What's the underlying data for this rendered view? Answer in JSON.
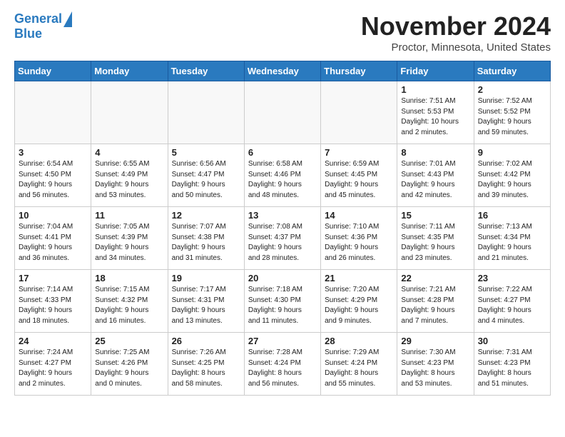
{
  "header": {
    "logo_line1": "General",
    "logo_line2": "Blue",
    "month_title": "November 2024",
    "location": "Proctor, Minnesota, United States"
  },
  "weekdays": [
    "Sunday",
    "Monday",
    "Tuesday",
    "Wednesday",
    "Thursday",
    "Friday",
    "Saturday"
  ],
  "weeks": [
    [
      {
        "day": "",
        "info": ""
      },
      {
        "day": "",
        "info": ""
      },
      {
        "day": "",
        "info": ""
      },
      {
        "day": "",
        "info": ""
      },
      {
        "day": "",
        "info": ""
      },
      {
        "day": "1",
        "info": "Sunrise: 7:51 AM\nSunset: 5:53 PM\nDaylight: 10 hours\nand 2 minutes."
      },
      {
        "day": "2",
        "info": "Sunrise: 7:52 AM\nSunset: 5:52 PM\nDaylight: 9 hours\nand 59 minutes."
      }
    ],
    [
      {
        "day": "3",
        "info": "Sunrise: 6:54 AM\nSunset: 4:50 PM\nDaylight: 9 hours\nand 56 minutes."
      },
      {
        "day": "4",
        "info": "Sunrise: 6:55 AM\nSunset: 4:49 PM\nDaylight: 9 hours\nand 53 minutes."
      },
      {
        "day": "5",
        "info": "Sunrise: 6:56 AM\nSunset: 4:47 PM\nDaylight: 9 hours\nand 50 minutes."
      },
      {
        "day": "6",
        "info": "Sunrise: 6:58 AM\nSunset: 4:46 PM\nDaylight: 9 hours\nand 48 minutes."
      },
      {
        "day": "7",
        "info": "Sunrise: 6:59 AM\nSunset: 4:45 PM\nDaylight: 9 hours\nand 45 minutes."
      },
      {
        "day": "8",
        "info": "Sunrise: 7:01 AM\nSunset: 4:43 PM\nDaylight: 9 hours\nand 42 minutes."
      },
      {
        "day": "9",
        "info": "Sunrise: 7:02 AM\nSunset: 4:42 PM\nDaylight: 9 hours\nand 39 minutes."
      }
    ],
    [
      {
        "day": "10",
        "info": "Sunrise: 7:04 AM\nSunset: 4:41 PM\nDaylight: 9 hours\nand 36 minutes."
      },
      {
        "day": "11",
        "info": "Sunrise: 7:05 AM\nSunset: 4:39 PM\nDaylight: 9 hours\nand 34 minutes."
      },
      {
        "day": "12",
        "info": "Sunrise: 7:07 AM\nSunset: 4:38 PM\nDaylight: 9 hours\nand 31 minutes."
      },
      {
        "day": "13",
        "info": "Sunrise: 7:08 AM\nSunset: 4:37 PM\nDaylight: 9 hours\nand 28 minutes."
      },
      {
        "day": "14",
        "info": "Sunrise: 7:10 AM\nSunset: 4:36 PM\nDaylight: 9 hours\nand 26 minutes."
      },
      {
        "day": "15",
        "info": "Sunrise: 7:11 AM\nSunset: 4:35 PM\nDaylight: 9 hours\nand 23 minutes."
      },
      {
        "day": "16",
        "info": "Sunrise: 7:13 AM\nSunset: 4:34 PM\nDaylight: 9 hours\nand 21 minutes."
      }
    ],
    [
      {
        "day": "17",
        "info": "Sunrise: 7:14 AM\nSunset: 4:33 PM\nDaylight: 9 hours\nand 18 minutes."
      },
      {
        "day": "18",
        "info": "Sunrise: 7:15 AM\nSunset: 4:32 PM\nDaylight: 9 hours\nand 16 minutes."
      },
      {
        "day": "19",
        "info": "Sunrise: 7:17 AM\nSunset: 4:31 PM\nDaylight: 9 hours\nand 13 minutes."
      },
      {
        "day": "20",
        "info": "Sunrise: 7:18 AM\nSunset: 4:30 PM\nDaylight: 9 hours\nand 11 minutes."
      },
      {
        "day": "21",
        "info": "Sunrise: 7:20 AM\nSunset: 4:29 PM\nDaylight: 9 hours\nand 9 minutes."
      },
      {
        "day": "22",
        "info": "Sunrise: 7:21 AM\nSunset: 4:28 PM\nDaylight: 9 hours\nand 7 minutes."
      },
      {
        "day": "23",
        "info": "Sunrise: 7:22 AM\nSunset: 4:27 PM\nDaylight: 9 hours\nand 4 minutes."
      }
    ],
    [
      {
        "day": "24",
        "info": "Sunrise: 7:24 AM\nSunset: 4:27 PM\nDaylight: 9 hours\nand 2 minutes."
      },
      {
        "day": "25",
        "info": "Sunrise: 7:25 AM\nSunset: 4:26 PM\nDaylight: 9 hours\nand 0 minutes."
      },
      {
        "day": "26",
        "info": "Sunrise: 7:26 AM\nSunset: 4:25 PM\nDaylight: 8 hours\nand 58 minutes."
      },
      {
        "day": "27",
        "info": "Sunrise: 7:28 AM\nSunset: 4:24 PM\nDaylight: 8 hours\nand 56 minutes."
      },
      {
        "day": "28",
        "info": "Sunrise: 7:29 AM\nSunset: 4:24 PM\nDaylight: 8 hours\nand 55 minutes."
      },
      {
        "day": "29",
        "info": "Sunrise: 7:30 AM\nSunset: 4:23 PM\nDaylight: 8 hours\nand 53 minutes."
      },
      {
        "day": "30",
        "info": "Sunrise: 7:31 AM\nSunset: 4:23 PM\nDaylight: 8 hours\nand 51 minutes."
      }
    ]
  ]
}
